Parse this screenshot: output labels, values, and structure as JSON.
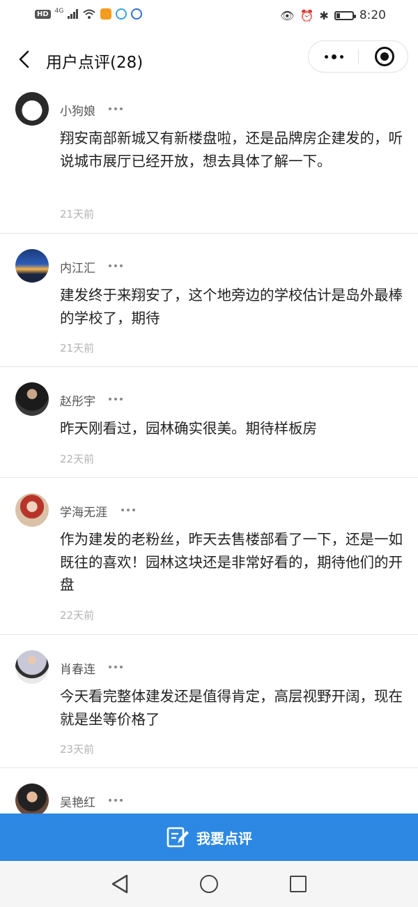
{
  "status_bar": {
    "network_badge": "HD",
    "network_type": "4G",
    "time": "8:20"
  },
  "header": {
    "title": "用户点评(28)"
  },
  "reviews": [
    {
      "username": "小狗娘",
      "text": "翔安南部新城又有新楼盘啦，还是品牌房企建发的，听说城市展厅已经开放，想去具体了解一下。",
      "time": "21天前"
    },
    {
      "username": "内江汇",
      "text": "建发终于来翔安了，这个地旁边的学校估计是岛外最棒的学校了，期待",
      "time": "21天前"
    },
    {
      "username": "赵彤宇",
      "text": "昨天刚看过，园林确实很美。期待样板房",
      "time": "22天前"
    },
    {
      "username": "学海无涯",
      "text": "作为建发的老粉丝，昨天去售楼部看了一下，还是一如既往的喜欢！园林这块还是非常好看的，期待他们的开盘",
      "time": "22天前"
    },
    {
      "username": "肖春连",
      "text": "今天看完整体建发还是值得肯定，高层视野开阔，现在就是坐等价格了",
      "time": "23天前"
    },
    {
      "username": "吴艳红",
      "text": "",
      "time": ""
    }
  ],
  "bottom_button": {
    "label": "我要点评"
  },
  "colors": {
    "accent": "#2c88e3",
    "time_text": "#b3b3b3",
    "username_text": "#555555"
  }
}
